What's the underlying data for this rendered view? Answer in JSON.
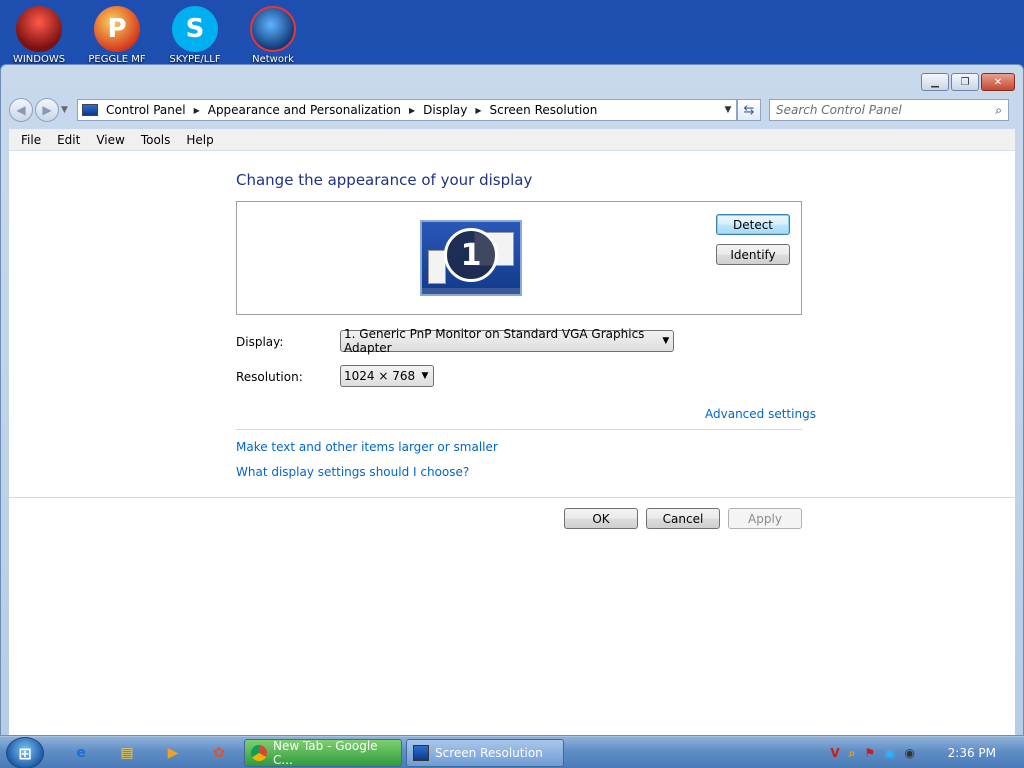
{
  "desktop": {
    "icons": [
      {
        "label": "WINDOWS",
        "icon": "windows-app-icon"
      },
      {
        "label": "PEGGLE MF",
        "icon": "peggle-icon"
      },
      {
        "label": "SKYPE/LLF",
        "icon": "skype-icon"
      },
      {
        "label": "Network",
        "icon": "network-icon"
      }
    ]
  },
  "window": {
    "breadcrumb": [
      "Control Panel",
      "Appearance and Personalization",
      "Display",
      "Screen Resolution"
    ],
    "search_placeholder": "Search Control Panel",
    "menu": [
      "File",
      "Edit",
      "View",
      "Tools",
      "Help"
    ]
  },
  "page": {
    "heading": "Change the appearance of your display",
    "monitor_number": "1",
    "detect_label": "Detect",
    "identify_label": "Identify",
    "display_label": "Display:",
    "display_value": "1. Generic PnP Monitor on Standard VGA Graphics Adapter",
    "resolution_label": "Resolution:",
    "resolution_value": "1024 × 768",
    "advanced_link": "Advanced settings",
    "link_text_size": "Make text and other items larger or smaller",
    "link_settings_help": "What display settings should I choose?",
    "ok_label": "OK",
    "cancel_label": "Cancel",
    "apply_label": "Apply"
  },
  "taskbar": {
    "start_icon": "windows-logo-icon",
    "pinned": [
      "ie-icon",
      "explorer-icon",
      "media-player-icon",
      "paint-icon"
    ],
    "tasks": [
      {
        "label": "New Tab - Google C...",
        "icon": "chrome-icon",
        "color": "#3fa646"
      },
      {
        "label": "Screen Resolution",
        "icon": "control-panel-icon",
        "color": "#6f9cd5"
      }
    ],
    "clock": "2:36 PM"
  },
  "colors": {
    "heading_blue": "#1e3287",
    "link_blue": "#0066cc"
  }
}
